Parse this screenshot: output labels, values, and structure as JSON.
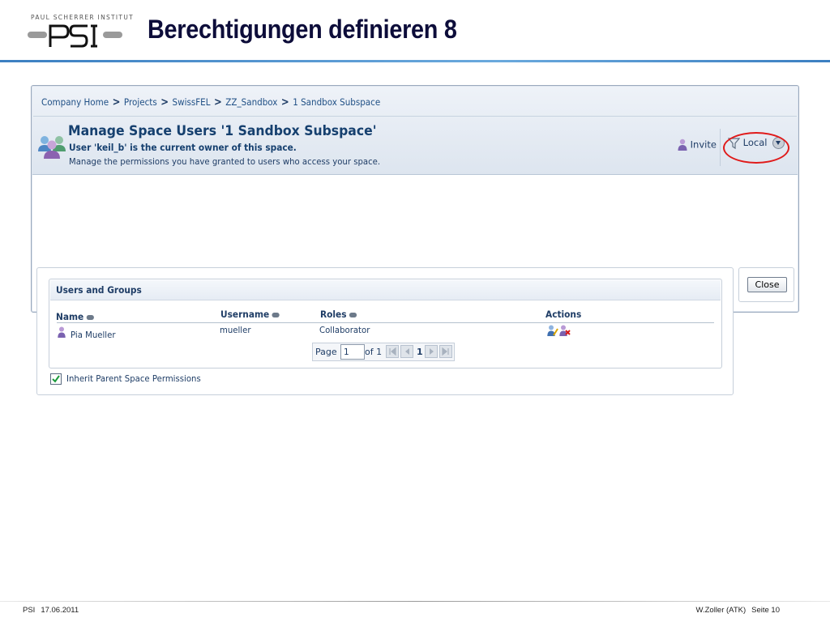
{
  "slide": {
    "logo_text": "PAUL SCHERRER INSTITUT",
    "logo_mark": "PSI",
    "title": "Berechtigungen definieren 8"
  },
  "breadcrumb": {
    "items": [
      "Company Home",
      "Projects",
      "SwissFEL",
      "ZZ_Sandbox",
      "1 Sandbox Subspace"
    ],
    "separator": ">"
  },
  "header": {
    "title": "Manage Space Users '1 Sandbox Subspace'",
    "owner": "User 'keil_b' is the current owner of this space.",
    "description": "Manage the permissions you have granted to users who access your space.",
    "invite_label": "Invite",
    "filter_label": "Local"
  },
  "users_groups": {
    "title": "Users and Groups",
    "columns": [
      "Name",
      "Username",
      "Roles",
      "Actions"
    ],
    "rows": [
      {
        "name": "Pia Mueller",
        "username": "mueller",
        "role": "Collaborator"
      }
    ]
  },
  "pager": {
    "page_label": "Page",
    "page_value": "1",
    "of_label": "of 1",
    "current": "1"
  },
  "inherit_label": "Inherit Parent Space Permissions",
  "close_label": "Close",
  "footer": {
    "org": "PSI",
    "date": "17.06.2011",
    "author": "W.Zoller (ATK)",
    "page": "Seite 10"
  },
  "colors": {
    "accent_blue": "#3c7fc1",
    "link_blue": "#1f4f85",
    "highlight_red": "#e01a1a"
  }
}
